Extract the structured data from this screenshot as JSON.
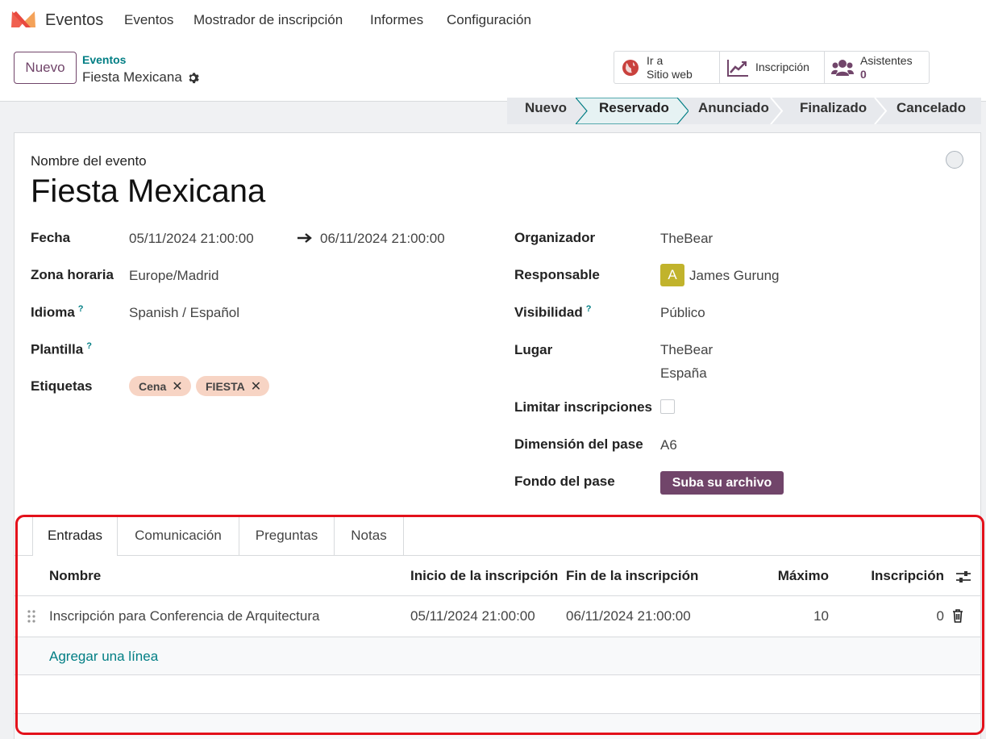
{
  "navbar": {
    "app_name": "Eventos",
    "menu": [
      "Eventos",
      "Mostrador de inscripción",
      "Informes",
      "Configuración"
    ]
  },
  "control": {
    "new_label": "Nuevo",
    "breadcrumb_parent": "Eventos",
    "breadcrumb_current": "Fiesta Mexicana",
    "smart_web_line1": "Ir a",
    "smart_web_line2": "Sitio web",
    "smart_insc": "Inscripción",
    "smart_asis_label": "Asistentes",
    "smart_asis_count": "0"
  },
  "status": {
    "stages": [
      "Nuevo",
      "Reservado",
      "Anunciado",
      "Finalizado",
      "Cancelado"
    ],
    "active": "Reservado"
  },
  "form": {
    "name_label": "Nombre del evento",
    "name": "Fiesta Mexicana",
    "fecha_label": "Fecha",
    "fecha_start": "05/11/2024 21:00:00",
    "fecha_end": "06/11/2024 21:00:00",
    "zona_label": "Zona horaria",
    "zona": "Europe/Madrid",
    "idioma_label": "Idioma",
    "idioma": "Spanish / Español",
    "plantilla_label": "Plantilla",
    "etiquetas_label": "Etiquetas",
    "tags": [
      "Cena",
      "FIESTA"
    ],
    "organizador_label": "Organizador",
    "organizador": "TheBear",
    "responsable_label": "Responsable",
    "responsable_initial": "A",
    "responsable": "James Gurung",
    "visibilidad_label": "Visibilidad",
    "visibilidad": "Público",
    "lugar_label": "Lugar",
    "lugar_line1": "TheBear",
    "lugar_line2": "España",
    "limitar_label": "Limitar inscripciones",
    "limitar_checked": false,
    "dimension_label": "Dimensión del pase",
    "dimension": "A6",
    "fondo_label": "Fondo del pase",
    "upload_label": "Suba su archivo",
    "help_mark": "?"
  },
  "notebook": {
    "tabs": [
      "Entradas",
      "Comunicación",
      "Preguntas",
      "Notas"
    ],
    "active_tab": "Entradas",
    "columns": [
      "Nombre",
      "Inicio de la inscripción",
      "Fin de la inscripción",
      "Máximo",
      "Inscripción"
    ],
    "rows": [
      {
        "nombre": "Inscripción para Conferencia de Arquitectura",
        "inicio": "05/11/2024 21:00:00",
        "fin": "06/11/2024 21:00:00",
        "maximo": "10",
        "inscripcion": "0"
      }
    ],
    "add_line": "Agregar una línea"
  },
  "colors": {
    "primary": "#71456a",
    "teal": "#017e84",
    "annotation_frame": "#e3111b"
  }
}
